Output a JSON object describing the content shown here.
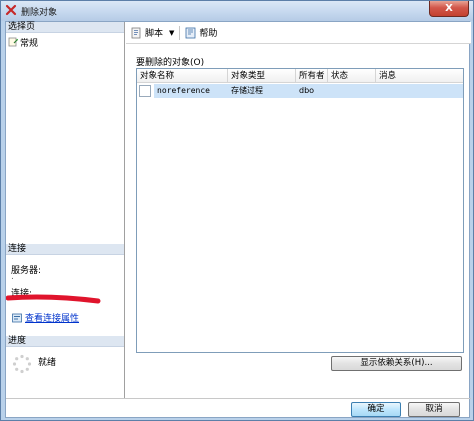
{
  "window": {
    "title": "删除对象",
    "close_glyph": "X"
  },
  "left": {
    "select_page_header": "选择页",
    "pages": [
      {
        "label": "常规",
        "icon": "page-icon"
      }
    ],
    "connection_header": "连接",
    "server_label": "服务器:",
    "server_value": ".",
    "connection_label": "连接:",
    "view_conn_props": "查看连接属性",
    "progress_header": "进度",
    "progress_status": "就绪"
  },
  "toolbar": {
    "script_label": "脚本",
    "help_label": "帮助"
  },
  "main": {
    "objects_label": "要删除的对象(O)",
    "columns": [
      "对象名称",
      "对象类型",
      "所有者",
      "状态",
      "消息"
    ],
    "rows": [
      {
        "name": "noreference",
        "type": "存储过程",
        "owner": "dbo",
        "status": "",
        "message": ""
      }
    ],
    "show_deps_button": "显示依赖关系(H)..."
  },
  "footer": {
    "ok_button": "确定",
    "cancel_button": "取消"
  },
  "colors": {
    "accent": "#3c7fb1",
    "selection": "#cde3f8",
    "redaction": "#e0142c"
  }
}
